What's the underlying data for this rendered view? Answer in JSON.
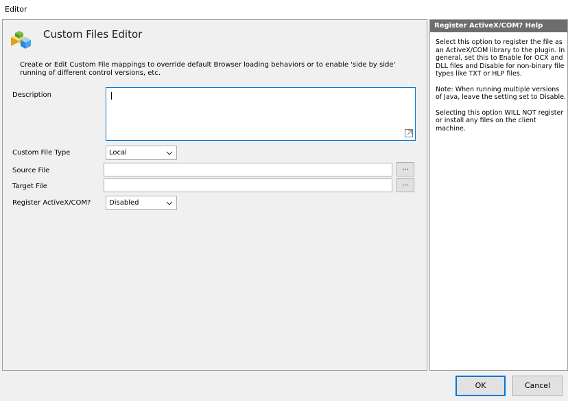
{
  "window": {
    "title": "Editor"
  },
  "header": {
    "title": "Custom Files Editor",
    "description": "Create or Edit Custom File mappings to override default Browser loading behaviors or to enable 'side by side' running of different control versions, etc."
  },
  "form": {
    "description_label": "Description",
    "description_value": "",
    "custom_file_type_label": "Custom File Type",
    "custom_file_type_value": "Local",
    "source_file_label": "Source File",
    "source_file_value": "",
    "target_file_label": "Target File",
    "target_file_value": "",
    "register_label": "Register ActiveX/COM?",
    "register_value": "Disabled",
    "browse_label": "..."
  },
  "help": {
    "title": "Register ActiveX/COM? Help",
    "paragraphs": [
      "Select this option to register the file as an ActiveX/COM library to the plugin. In general, set this to Enable for OCX and DLL files and Disable for non-binary file types like TXT or HLP files.",
      "Note: When running multiple versions of Java, leave the setting set to Disable.",
      " Selecting this option WILL NOT register or install any files on the client machine."
    ]
  },
  "footer": {
    "ok_label": "OK",
    "cancel_label": "Cancel"
  },
  "colors": {
    "accent": "#0078d7",
    "help_title_bg": "#6d6d6d"
  }
}
